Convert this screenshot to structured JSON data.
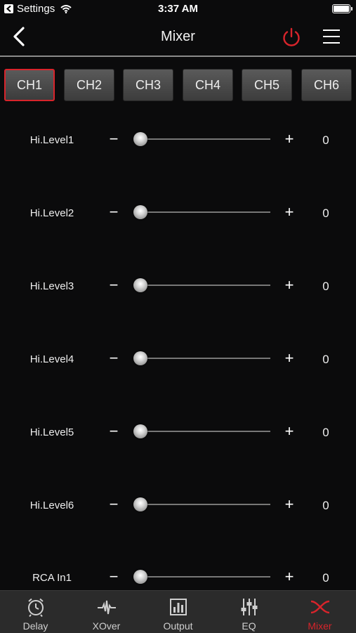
{
  "status": {
    "carrier": "Settings",
    "time": "3:37 AM"
  },
  "nav": {
    "title": "Mixer"
  },
  "channels": [
    "CH1",
    "CH2",
    "CH3",
    "CH4",
    "CH5",
    "CH6"
  ],
  "active_channel": "CH1",
  "rows": [
    {
      "label": "Hi.Level1",
      "value": "0",
      "minus": "−",
      "plus": "+"
    },
    {
      "label": "Hi.Level2",
      "value": "0",
      "minus": "−",
      "plus": "+"
    },
    {
      "label": "Hi.Level3",
      "value": "0",
      "minus": "−",
      "plus": "+"
    },
    {
      "label": "Hi.Level4",
      "value": "0",
      "minus": "−",
      "plus": "+"
    },
    {
      "label": "Hi.Level5",
      "value": "0",
      "minus": "−",
      "plus": "+"
    },
    {
      "label": "Hi.Level6",
      "value": "0",
      "minus": "−",
      "plus": "+"
    },
    {
      "label": "RCA In1",
      "value": "0",
      "minus": "−",
      "plus": "+"
    }
  ],
  "tabs": [
    {
      "label": "Delay",
      "icon": "clock-icon"
    },
    {
      "label": "XOver",
      "icon": "crossover-wave-icon"
    },
    {
      "label": "Output",
      "icon": "output-bars-icon"
    },
    {
      "label": "EQ",
      "icon": "eq-sliders-icon"
    },
    {
      "label": "Mixer",
      "icon": "mixer-cross-icon"
    }
  ],
  "colors": {
    "accent": "#d8242b",
    "background": "#0b0b0c",
    "tab_bar": "#2b2b2b"
  }
}
